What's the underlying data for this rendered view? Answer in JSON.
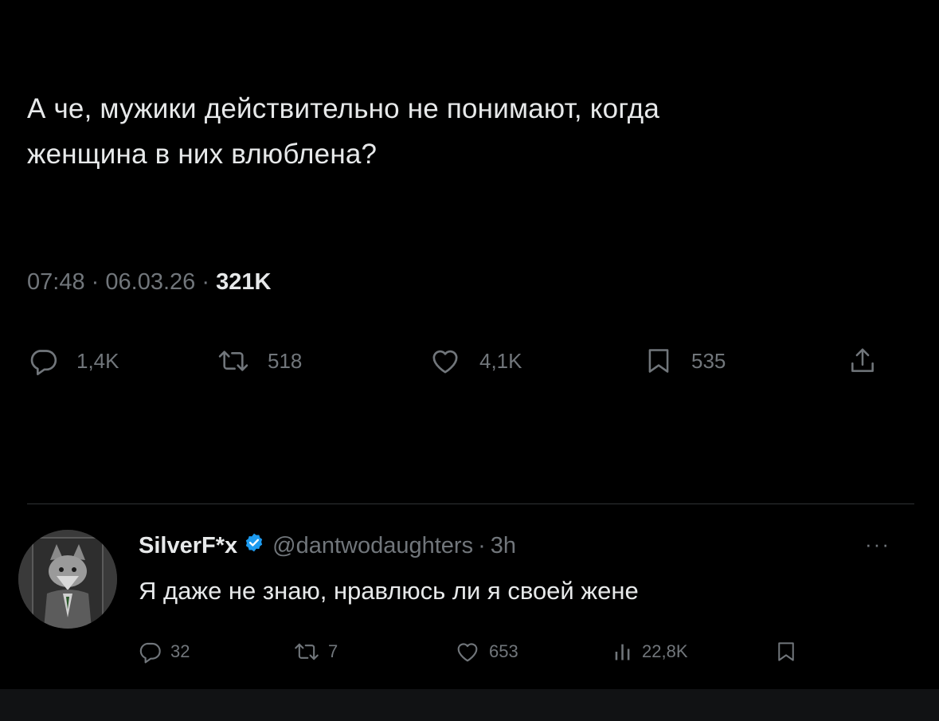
{
  "tweet": {
    "text_line1": "А че, мужики действительно не понимают, когда",
    "text_line2": "женщина в них влюблена?",
    "time": "07:48",
    "date": "06.03.26",
    "views": "321K",
    "separator": "·",
    "replies": "1,4K",
    "retweets": "518",
    "likes": "4,1K",
    "bookmarks": "535"
  },
  "reply": {
    "author_name": "SilverF*x",
    "handle": "@dantwodaughters",
    "separator": "·",
    "time": "3h",
    "more": "···",
    "text": "Я даже не знаю, нравлюсь ли я своей жене",
    "replies": "32",
    "retweets": "7",
    "likes": "653",
    "views": "22,8K"
  },
  "icons": {
    "reply": "comment-icon",
    "retweet": "retweet-icon",
    "like": "heart-icon",
    "bookmark": "bookmark-icon",
    "share": "share-icon",
    "views": "analytics-icon",
    "verified": "verified-badge-icon"
  },
  "colors": {
    "background": "#000000",
    "text": "#e7e9ea",
    "secondary": "#71767b",
    "verified": "#1d9bf0",
    "divider": "#2f3336"
  }
}
